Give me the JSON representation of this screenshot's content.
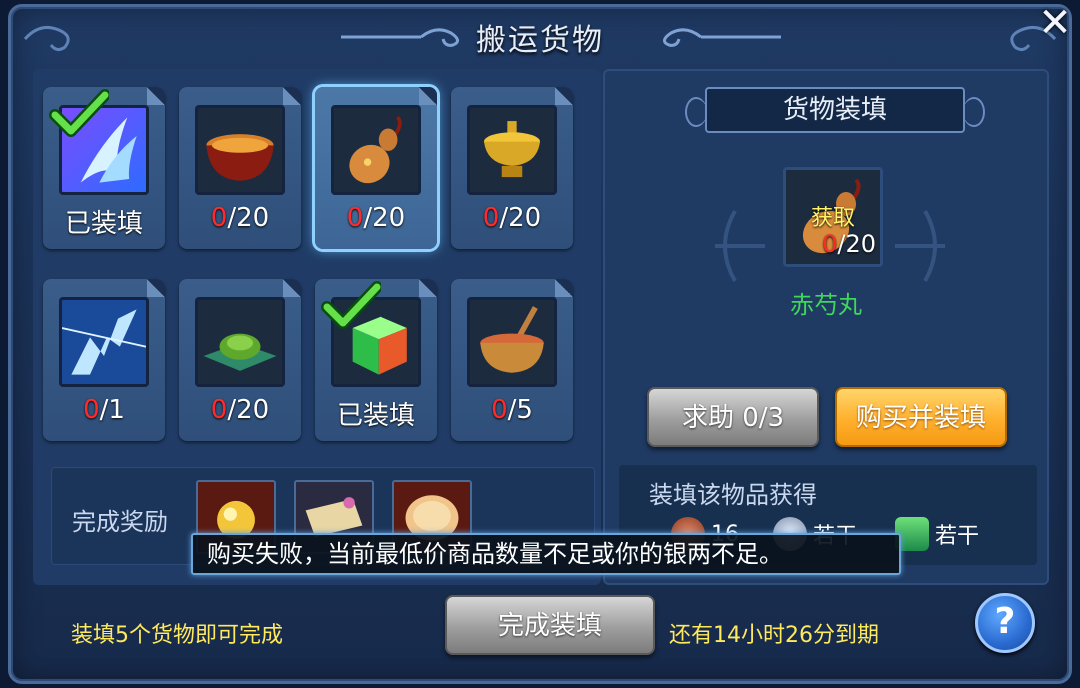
{
  "window": {
    "title": "搬运货物",
    "close_icon": "close-icon"
  },
  "slots": [
    {
      "count": "已装填",
      "zero": "",
      "rest": "",
      "filled": true,
      "icon": "wing-blade-icon"
    },
    {
      "count": "",
      "zero": "0",
      "rest": "/20",
      "filled": false,
      "icon": "bowl-stew-icon"
    },
    {
      "count": "",
      "zero": "0",
      "rest": "/20",
      "filled": false,
      "icon": "gourd-icon",
      "selected": true
    },
    {
      "count": "",
      "zero": "0",
      "rest": "/20",
      "filled": false,
      "icon": "hotpot-icon"
    },
    {
      "count": "",
      "zero": "0",
      "rest": "/1",
      "filled": false,
      "icon": "lightning-claw-icon"
    },
    {
      "count": "",
      "zero": "0",
      "rest": "/20",
      "filled": false,
      "icon": "herb-plate-icon"
    },
    {
      "count": "已装填",
      "zero": "",
      "rest": "",
      "filled": true,
      "icon": "jade-cube-icon"
    },
    {
      "count": "",
      "zero": "0",
      "rest": "/5",
      "filled": false,
      "icon": "mortar-bowl-icon"
    }
  ],
  "rewards": {
    "label": "完成奖励",
    "items": [
      "gold-orb-icon",
      "scroll-icon",
      "pastry-icon"
    ]
  },
  "cargo": {
    "header": "货物装填",
    "get_label": "获取",
    "count_zero": "0",
    "count_rest": "/20",
    "item_name": "赤芍丸",
    "help_button": "求助 0/3",
    "buy_button": "购买并装填"
  },
  "gain": {
    "label": "装填该物品获得",
    "items": [
      {
        "icon": "copper-coin-icon",
        "value": "16"
      },
      {
        "icon": "silver-coin-icon",
        "value": "若干"
      },
      {
        "icon": "exp-icon",
        "value": "若干"
      }
    ]
  },
  "footer": {
    "left_text": "装填5个货物即可完成",
    "complete_button": "完成装填",
    "right_text": "还有14小时26分到期",
    "help_symbol": "?"
  },
  "toast": {
    "message": "购买失败，当前最低价商品数量不足或你的银两不足。"
  },
  "colors": {
    "zero_red": "#ff2b2b",
    "name_green": "#3fd65a",
    "footer_yellow": "#ffe95c",
    "buy_orange": "#ffb02e"
  }
}
